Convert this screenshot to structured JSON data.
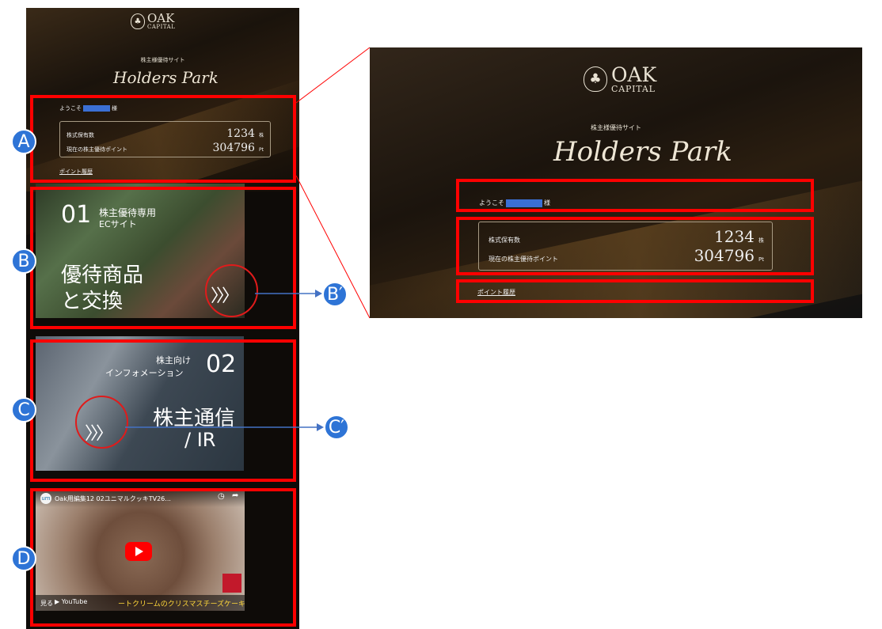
{
  "logo": {
    "name": "OAK",
    "sub": "CAPITAL"
  },
  "site": {
    "subtitle": "株主様優待サイト",
    "title_script": "Holders Park"
  },
  "welcome": {
    "prefix": "ようこそ",
    "suffix": "様"
  },
  "stats": {
    "shares_label": "株式保有数",
    "shares_value": "1234",
    "shares_unit": "株",
    "points_label": "現在の株主優待ポイント",
    "points_value": "304796",
    "points_unit": "Pt"
  },
  "point_history_link": "ポイント履歴",
  "tile_ec": {
    "number": "01",
    "label_line1": "株主優待専用",
    "label_line2": "ECサイト",
    "headline_line1": "優待商品",
    "headline_line2": "と交換",
    "arrow": "〉〉〉"
  },
  "tile_ir": {
    "number": "02",
    "label_line1": "株主向け",
    "label_line2": "インフォメーション",
    "headline_line1": "株主通信",
    "headline_line2": "/ IR",
    "arrow": "〉〉〉"
  },
  "video": {
    "title": "Oak用編集12 02ユニマルクッキTV26...",
    "caption": "ートクリームのクリスマスチーズケーキ",
    "watch_label": "見る",
    "platform": "YouTube",
    "channel_initials": "um"
  },
  "annotations": {
    "a": "A",
    "b": "B",
    "c": "C",
    "d": "D",
    "b_prime": "B′",
    "c_prime": "C′"
  },
  "colors": {
    "annotation_red": "#ff0000",
    "badge_blue": "#2e74d6",
    "connector_blue": "#4472c4"
  }
}
